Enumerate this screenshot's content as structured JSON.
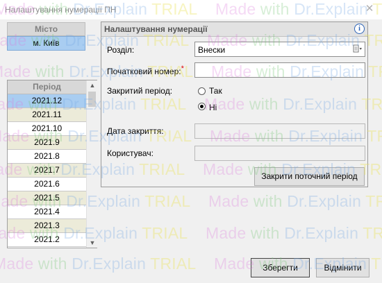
{
  "window": {
    "title": "Налаштування нумерації ПН",
    "close_glyph": "✕"
  },
  "city": {
    "header": "Місто",
    "value": "м. Київ"
  },
  "period": {
    "header": "Період",
    "items": [
      "2021.12",
      "2021.11",
      "2021.10",
      "2021.9",
      "2021.8",
      "2021.7",
      "2021.6",
      "2021.5",
      "2021.4",
      "2021.3",
      "2021.2"
    ],
    "selected_index": 0,
    "scroll_up": "▲",
    "scroll_down": "▼"
  },
  "form": {
    "title": "Налаштування нумерації",
    "info_glyph": "i",
    "section_label": "Розділ:",
    "section_value": "Внески",
    "start_number_label": "Початковий номер:",
    "required_mark": "*",
    "start_number_value": "",
    "closed_period_label": "Закритий період:",
    "radio_yes": "Так",
    "radio_no": "Ні",
    "closed_selected": "no",
    "close_date_label": "Дата закриття:",
    "close_date_value": "",
    "user_label": "Користувач:",
    "user_value": "",
    "close_period_button": "Закрити поточний період"
  },
  "buttons": {
    "save": "Зберегти",
    "cancel": "Відмінити"
  },
  "watermark": {
    "line": [
      "Made",
      " with ",
      "Dr.Explain",
      " TRIAL"
    ]
  },
  "colors": {
    "selected_row": "#a9cdf1",
    "alt_row": "#ecebd9",
    "required": "#dd0000",
    "info": "#2a62b6"
  }
}
